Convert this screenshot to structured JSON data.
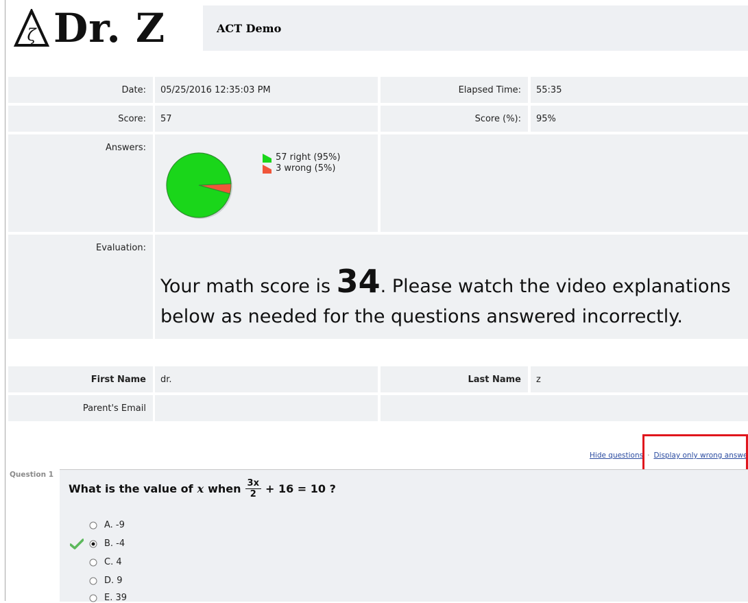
{
  "header": {
    "logo_text": "Dr. Z",
    "logo_symbol": "ζ",
    "title": "ACT Demo"
  },
  "info": {
    "date_label": "Date:",
    "date_value": "05/25/2016 12:35:03 PM",
    "elapsed_label": "Elapsed Time:",
    "elapsed_value": "55:35",
    "score_label": "Score:",
    "score_value": "57",
    "score_pct_label": "Score (%):",
    "score_pct_value": "95%",
    "answers_label": "Answers:",
    "evaluation_label": "Evaluation:",
    "first_name_label": "First Name",
    "first_name_value": "dr.",
    "last_name_label": "Last Name",
    "last_name_value": "z",
    "parent_email_label": "Parent's Email"
  },
  "chart_data": {
    "type": "pie",
    "slices": [
      {
        "label": "57 right (95%)",
        "value": 57,
        "color": "#1ad61a"
      },
      {
        "label": "3 wrong (5%)",
        "value": 3,
        "color": "#f0563a"
      }
    ]
  },
  "evaluation": {
    "prefix": "Your math score is ",
    "score": "34",
    "suffix": ". Please watch the video explanations below as needed for the questions answered incorrectly."
  },
  "links": {
    "hide_questions": "Hide questions",
    "separator": "·",
    "display_wrong": "Display only wrong answers"
  },
  "question": {
    "label": "Question 1",
    "text_before": "What is the value of",
    "variable": "x",
    "when": "when",
    "frac_num": "3x",
    "frac_den": "2",
    "text_after": "+ 16 = 10 ?",
    "options": [
      {
        "label": "A. -9",
        "selected": false
      },
      {
        "label": "B. -4",
        "selected": true,
        "correct": true
      },
      {
        "label": "C. 4",
        "selected": false
      },
      {
        "label": "D. 9",
        "selected": false
      },
      {
        "label": "E. 39",
        "selected": false
      }
    ]
  },
  "colors": {
    "cell_bg": "#eff1f3",
    "right": "#1ad61a",
    "wrong": "#f0563a",
    "highlight": "#e0161d",
    "link": "#2a4ba0"
  }
}
